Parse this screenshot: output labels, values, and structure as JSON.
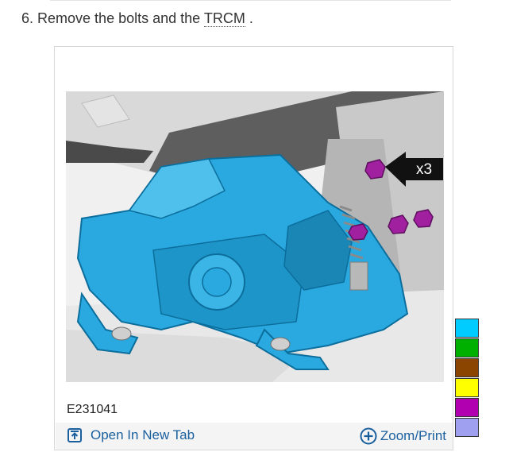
{
  "step": {
    "number": "6.",
    "text": "Remove the bolts and the",
    "abbreviation": "TRCM",
    "suffix": "."
  },
  "figure": {
    "callout_label": "x3",
    "figure_id": "E231041",
    "open_in_new_tab": "Open In New Tab",
    "zoom_print": "Zoom/Print"
  },
  "colors": {
    "component_highlight": "#2aa9e0",
    "bolt_highlight": "#a020a0",
    "link_color": "#1a5f9e"
  },
  "color_swatches": [
    "#00ccff",
    "#00b000",
    "#8b4500",
    "#ffff00",
    "#b000b0",
    "#a0a0f0"
  ],
  "icons": {
    "open_tab": "open-in-new-tab-icon",
    "zoom": "zoom-plus-circle-icon",
    "callout": "arrow-callout-icon"
  }
}
